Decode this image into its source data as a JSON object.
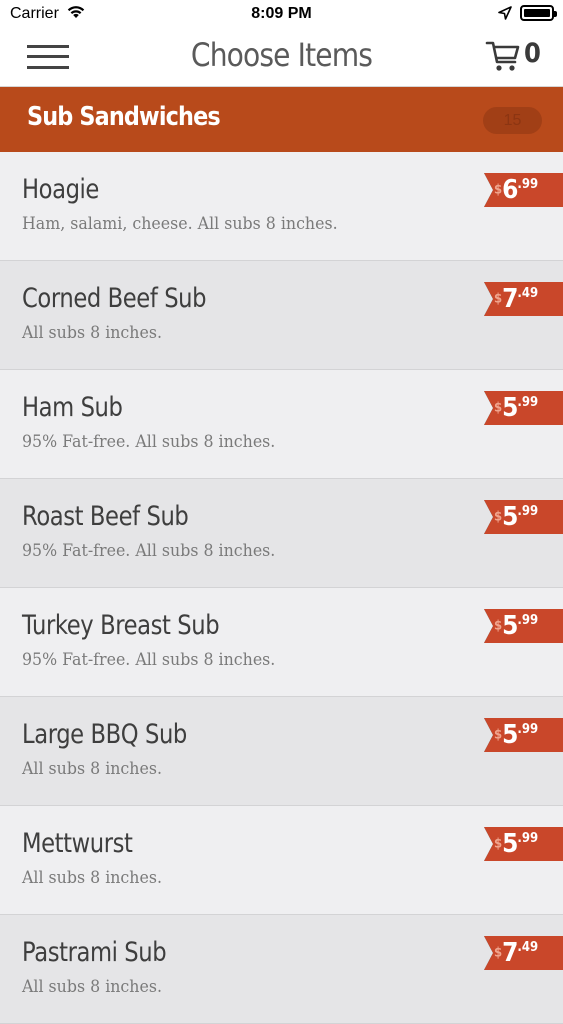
{
  "status_bar": {
    "carrier": "Carrier",
    "time": "8:09 PM"
  },
  "nav": {
    "title": "Choose Items",
    "cart_count": "0"
  },
  "category": {
    "name": "Sub Sandwiches",
    "count": "15"
  },
  "currency_symbol": "$",
  "items": [
    {
      "name": "Hoagie",
      "description": "Ham, salami, cheese. All subs 8 inches.",
      "price_whole": "6",
      "price_cents": ".99"
    },
    {
      "name": "Corned Beef Sub",
      "description": "All subs 8 inches.",
      "price_whole": "7",
      "price_cents": ".49"
    },
    {
      "name": "Ham Sub",
      "description": "95% Fat-free. All subs 8 inches.",
      "price_whole": "5",
      "price_cents": ".99"
    },
    {
      "name": "Roast Beef Sub",
      "description": "95% Fat-free. All subs 8 inches.",
      "price_whole": "5",
      "price_cents": ".99"
    },
    {
      "name": "Turkey Breast Sub",
      "description": "95% Fat-free. All subs 8 inches.",
      "price_whole": "5",
      "price_cents": ".99"
    },
    {
      "name": "Large BBQ Sub",
      "description": "All subs 8 inches.",
      "price_whole": "5",
      "price_cents": ".99"
    },
    {
      "name": "Mettwurst",
      "description": "All subs 8 inches.",
      "price_whole": "5",
      "price_cents": ".99"
    },
    {
      "name": "Pastrami Sub",
      "description": "All subs 8 inches.",
      "price_whole": "7",
      "price_cents": ".49"
    }
  ],
  "colors": {
    "accent": "#b84a1b",
    "price_tag": "#c9472a"
  },
  "icons": {
    "menu": "hamburger-menu-icon",
    "cart": "shopping-cart-icon",
    "wifi": "wifi-icon",
    "location": "location-arrow-icon",
    "battery": "battery-icon"
  }
}
